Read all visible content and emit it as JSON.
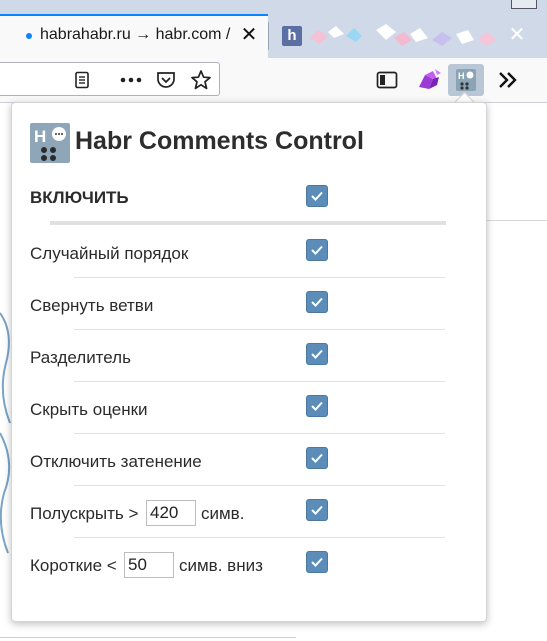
{
  "browser": {
    "active_tab_title": "habrahabr.ru → habr.com /",
    "second_tab_favicon": "h",
    "close_glyph": "✕"
  },
  "navbar": {
    "icons": [
      "reader-view-icon",
      "more-icon",
      "pocket-icon",
      "bookmark-star-icon",
      "sidebar-icon",
      "extension-icon",
      "habr-extension-icon",
      "overflow-chevron-icon"
    ]
  },
  "popup": {
    "title": "Habr Comments Control",
    "enable": {
      "label": "ВКЛЮЧИТЬ",
      "checked": true
    },
    "options": [
      {
        "label": "Случайный порядок",
        "checked": true
      },
      {
        "label": "Свернуть ветви",
        "checked": true
      },
      {
        "label": "Разделитель",
        "checked": true
      },
      {
        "label": "Скрыть оценки",
        "checked": true
      },
      {
        "label": "Отключить затенение",
        "checked": true
      }
    ],
    "semi_hide": {
      "prefix": "Полускрыть >",
      "value": "420",
      "suffix": "симв.",
      "checked": true
    },
    "short": {
      "prefix": "Короткие <",
      "value": "50",
      "suffix": "симв. вниз",
      "checked": true
    }
  },
  "colors": {
    "checkbox": "#5b8db8",
    "tab_accent": "#0a84ff"
  }
}
